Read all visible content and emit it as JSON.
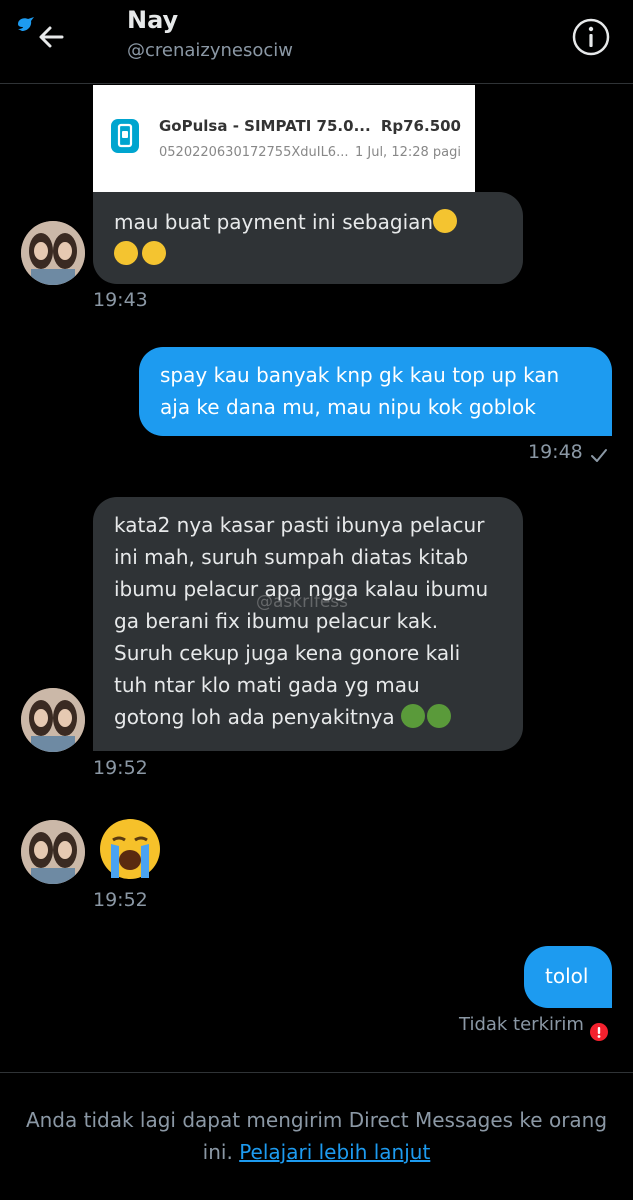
{
  "header": {
    "name": "Nay",
    "handle": "@crenaizynesociw"
  },
  "attachment": {
    "title": "GoPulsa - SIMPATI 75.0...",
    "subtitle": "0520220630172755XduIL6...",
    "amount": "Rp76.500",
    "date": "1 Jul, 12:28 pagi"
  },
  "messages": [
    {
      "text": "mau buat payment ini sebagian",
      "time": "19:43"
    },
    {
      "text_line1": "spay kau banyak knp gk kau top up kan",
      "text_line2": "aja ke dana mu, mau nipu kok goblok",
      "time": "19:48"
    },
    {
      "lines": [
        "kata2 nya kasar pasti ibunya pelacur",
        "ini mah, suruh sumpah diatas kitab",
        "ibumu pelacur apa ngga kalau ibumu",
        "ga berani fix ibumu pelacur kak.",
        "Suruh cekup juga kena gonore kali",
        "tuh ntar klo mati gada yg mau",
        "gotong loh ada penyakitnya"
      ],
      "time": "19:52",
      "watermark": "@askrlfess"
    },
    {
      "time": "19:52"
    },
    {
      "text": "tolol",
      "status": "Tidak terkirim"
    }
  ],
  "footer": {
    "text": "Anda tidak lagi dapat mengirim Direct Messages ke orang ini.",
    "link": "Pelajari lebih lanjut"
  }
}
